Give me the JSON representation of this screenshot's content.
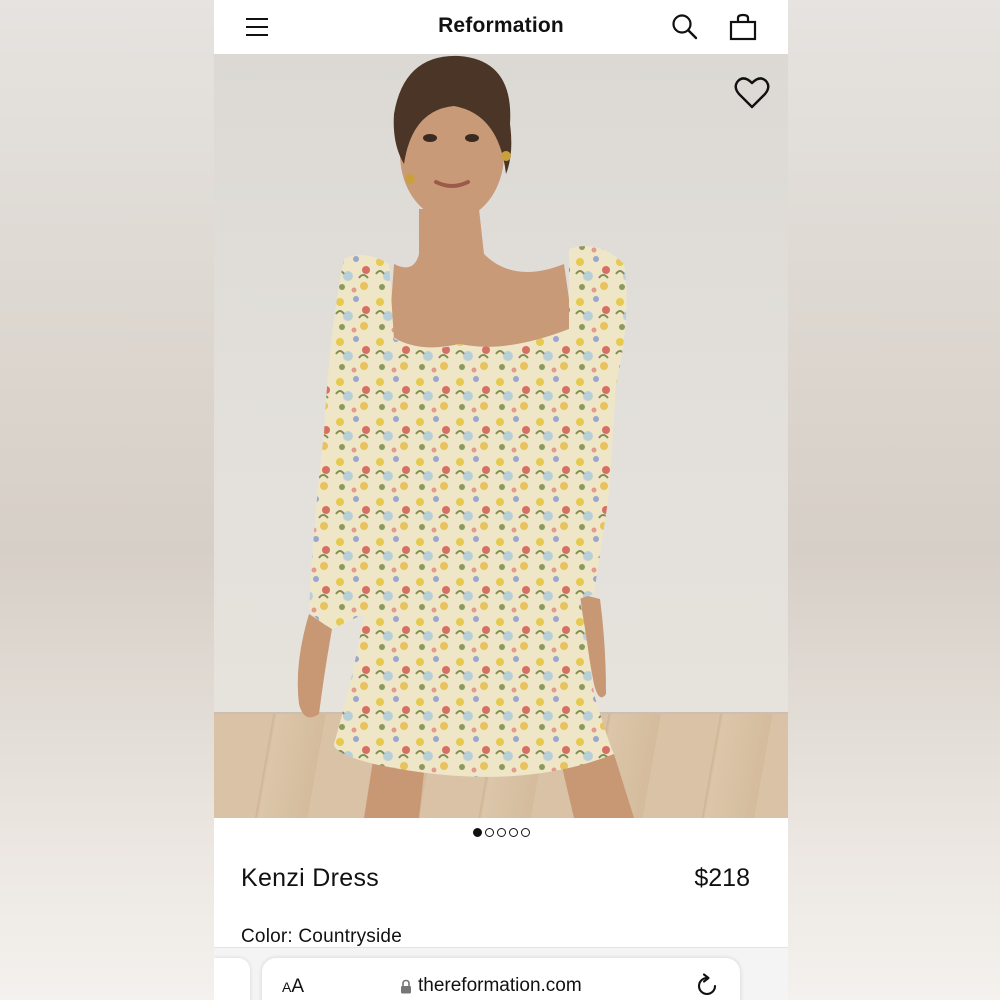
{
  "header": {
    "logo": "Reformation",
    "icons": [
      "menu-icon",
      "search-icon",
      "shopping-bag-icon"
    ]
  },
  "product": {
    "name": "Kenzi Dress",
    "price": "$218",
    "color_label": "Color:",
    "color_value": "Countryside",
    "wishlist_icon": "heart-icon",
    "carousel": {
      "total": 5,
      "active_index": 0
    }
  },
  "browser": {
    "text_size_label_small": "A",
    "text_size_label_large": "A",
    "url": "thereformation.com",
    "icons": [
      "lock-icon",
      "reload-icon"
    ]
  }
}
